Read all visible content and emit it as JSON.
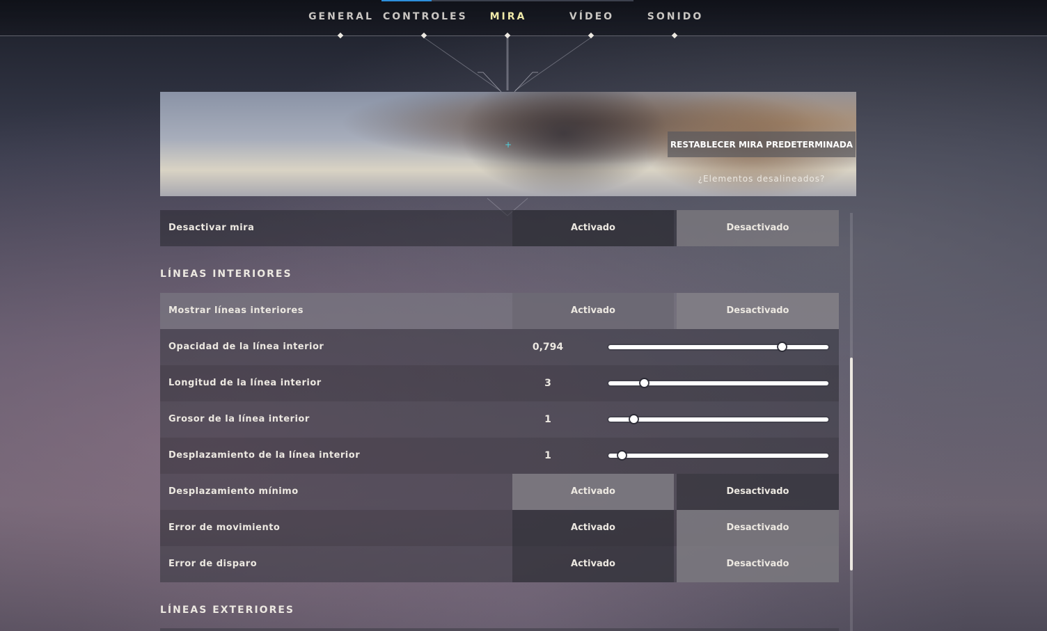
{
  "tabs": [
    {
      "label": "GENERAL",
      "active": false
    },
    {
      "label": "CONTROLES",
      "active": false
    },
    {
      "label": "MIRA",
      "active": true
    },
    {
      "label": "VÍDEO",
      "active": false
    },
    {
      "label": "SONIDO",
      "active": false
    }
  ],
  "colors": {
    "active_tab": "#efe9a8",
    "tab_indicator": "#2d8fdc",
    "crosshair": "#4fd3e0"
  },
  "preview": {
    "reset_label": "RESTABLECER MIRA PREDETERMINADA",
    "misaligned_label": "¿Elementos desalineados?"
  },
  "disable_crosshair": {
    "label": "Desactivar mira",
    "on": "Activado",
    "off": "Desactivado",
    "selected": "off"
  },
  "inner_lines": {
    "title": "LÍNEAS INTERIORES",
    "show": {
      "label": "Mostrar líneas interiores",
      "on": "Activado",
      "off": "Desactivado",
      "selected": "off"
    },
    "opacity": {
      "label": "Opacidad de la línea interior",
      "value": "0,794",
      "fraction": 0.8
    },
    "length": {
      "label": "Longitud de la línea interior",
      "value": "3",
      "fraction": 0.15
    },
    "thickness": {
      "label": "Grosor de la línea interior",
      "value": "1",
      "fraction": 0.1
    },
    "offset": {
      "label": "Desplazamiento de la línea interior",
      "value": "1",
      "fraction": 0.045
    },
    "min_offset": {
      "label": "Desplazamiento mínimo",
      "on": "Activado",
      "off": "Desactivado",
      "selected": "on"
    },
    "movement_error": {
      "label": "Error de movimiento",
      "on": "Activado",
      "off": "Desactivado",
      "selected": "off"
    },
    "firing_error": {
      "label": "Error de disparo",
      "on": "Activado",
      "off": "Desactivado",
      "selected": "off"
    }
  },
  "outer_lines": {
    "title": "LÍNEAS EXTERIORES"
  }
}
